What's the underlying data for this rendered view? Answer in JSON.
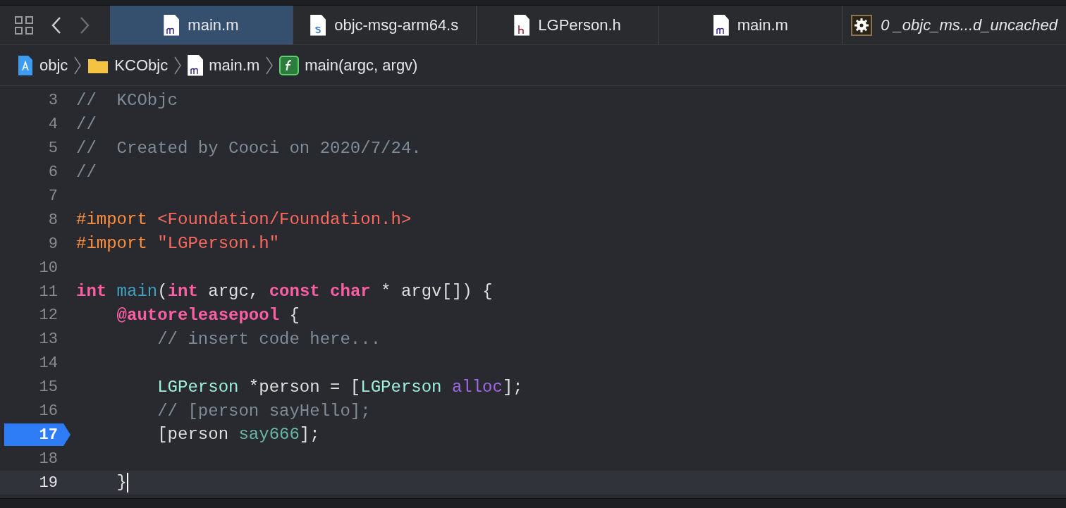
{
  "tabs": [
    {
      "label": "main.m",
      "kind": "m",
      "selected": true
    },
    {
      "label": "objc-msg-arm64.s",
      "kind": "s",
      "selected": false
    },
    {
      "label": "LGPerson.h",
      "kind": "h",
      "selected": false
    },
    {
      "label": "main.m",
      "kind": "m",
      "selected": false
    },
    {
      "label": "0 _objc_ms...d_uncached",
      "kind": "generated",
      "selected": false
    }
  ],
  "breadcrumb": [
    {
      "label": "objc",
      "kind": "project"
    },
    {
      "label": "KCObjc",
      "kind": "folder"
    },
    {
      "label": "main.m",
      "kind": "m"
    },
    {
      "label": "main(argc, argv)",
      "kind": "function"
    }
  ],
  "editor": {
    "lines": [
      {
        "number": "3",
        "breakpoint": false,
        "current": false,
        "tokens": [
          {
            "text": "//  KCObjc",
            "kind": "comment"
          }
        ]
      },
      {
        "number": "4",
        "breakpoint": false,
        "current": false,
        "tokens": [
          {
            "text": "//",
            "kind": "comment"
          }
        ]
      },
      {
        "number": "5",
        "breakpoint": false,
        "current": false,
        "tokens": [
          {
            "text": "//  Created by Cooci on 2020/7/24.",
            "kind": "comment"
          }
        ]
      },
      {
        "number": "6",
        "breakpoint": false,
        "current": false,
        "tokens": [
          {
            "text": "//",
            "kind": "comment"
          }
        ]
      },
      {
        "number": "7",
        "breakpoint": false,
        "current": false
      },
      {
        "number": "8",
        "breakpoint": false,
        "current": false,
        "tokens": [
          {
            "text": "#import ",
            "kind": "preproc"
          },
          {
            "text": "<Foundation/Foundation.h>",
            "kind": "string"
          }
        ]
      },
      {
        "number": "9",
        "breakpoint": false,
        "current": false,
        "tokens": [
          {
            "text": "#import ",
            "kind": "preproc"
          },
          {
            "text": "\"LGPerson.h\"",
            "kind": "string"
          }
        ]
      },
      {
        "number": "10",
        "breakpoint": false,
        "current": false
      },
      {
        "number": "11",
        "breakpoint": false,
        "current": false,
        "tokens": [
          {
            "text": "int ",
            "kind": "keyword"
          },
          {
            "text": "main",
            "kind": "declaration"
          },
          {
            "text": "(",
            "kind": "plain"
          },
          {
            "text": "int",
            "kind": "keyword"
          },
          {
            "text": " argc, ",
            "kind": "plain"
          },
          {
            "text": "const char",
            "kind": "keyword"
          },
          {
            "text": " * argv[]) {",
            "kind": "plain"
          }
        ]
      },
      {
        "number": "12",
        "breakpoint": false,
        "current": false,
        "tokens": [
          {
            "text": "    @autoreleasepool",
            "kind": "keyword"
          },
          {
            "text": " {",
            "kind": "plain"
          }
        ]
      },
      {
        "number": "13",
        "breakpoint": false,
        "current": false,
        "tokens": [
          {
            "text": "        // insert code here...",
            "kind": "comment"
          }
        ]
      },
      {
        "number": "14",
        "breakpoint": false,
        "current": false
      },
      {
        "number": "15",
        "breakpoint": false,
        "current": false,
        "tokens": [
          {
            "text": "        LGPerson",
            "kind": "class"
          },
          {
            "text": " *person = [",
            "kind": "plain"
          },
          {
            "text": "LGPerson",
            "kind": "class"
          },
          {
            "text": " alloc",
            "kind": "method"
          },
          {
            "text": "];",
            "kind": "plain"
          }
        ]
      },
      {
        "number": "16",
        "breakpoint": false,
        "current": false,
        "tokens": [
          {
            "text": "        // [person sayHello];",
            "kind": "comment"
          }
        ]
      },
      {
        "number": "17",
        "breakpoint": true,
        "current": false,
        "tokens": [
          {
            "text": "        [person ",
            "kind": "plain"
          },
          {
            "text": "say666",
            "kind": "project-method"
          },
          {
            "text": "];",
            "kind": "plain"
          }
        ]
      },
      {
        "number": "18",
        "breakpoint": false,
        "current": false
      },
      {
        "number": "19",
        "breakpoint": false,
        "current": true,
        "tokens": [
          {
            "text": "    }",
            "kind": "plain"
          }
        ]
      }
    ]
  }
}
